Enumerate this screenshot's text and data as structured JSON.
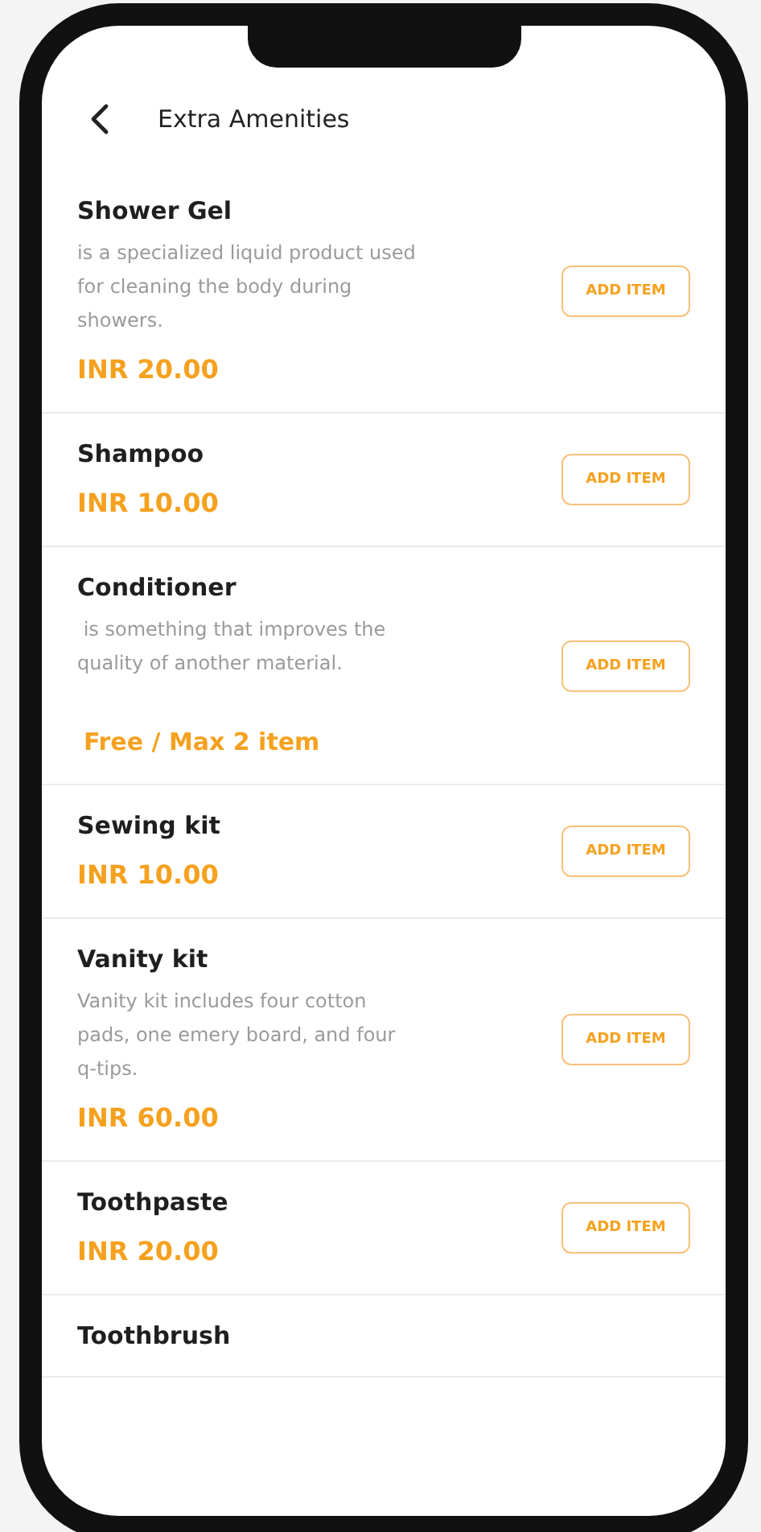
{
  "header": {
    "title": "Extra Amenities"
  },
  "items": [
    {
      "name": "Shower Gel",
      "description": "is a specialized liquid product used for cleaning the body during showers.",
      "price": "INR 20.00",
      "button": "ADD ITEM"
    },
    {
      "name": "Shampoo",
      "price": "INR 10.00",
      "button": "ADD ITEM"
    },
    {
      "name": "Conditioner",
      "description": " is something that improves the quality of another material.",
      "price": "Free / Max 2 item",
      "button": "ADD ITEM"
    },
    {
      "name": "Sewing kit",
      "price": "INR 10.00",
      "button": "ADD ITEM"
    },
    {
      "name": "Vanity kit",
      "description": "Vanity kit includes four cotton pads, one emery board, and four q-tips.",
      "price": "INR 60.00",
      "button": "ADD ITEM"
    },
    {
      "name": "Toothpaste",
      "price": "INR 20.00",
      "button": "ADD ITEM"
    },
    {
      "name": "Toothbrush"
    }
  ]
}
